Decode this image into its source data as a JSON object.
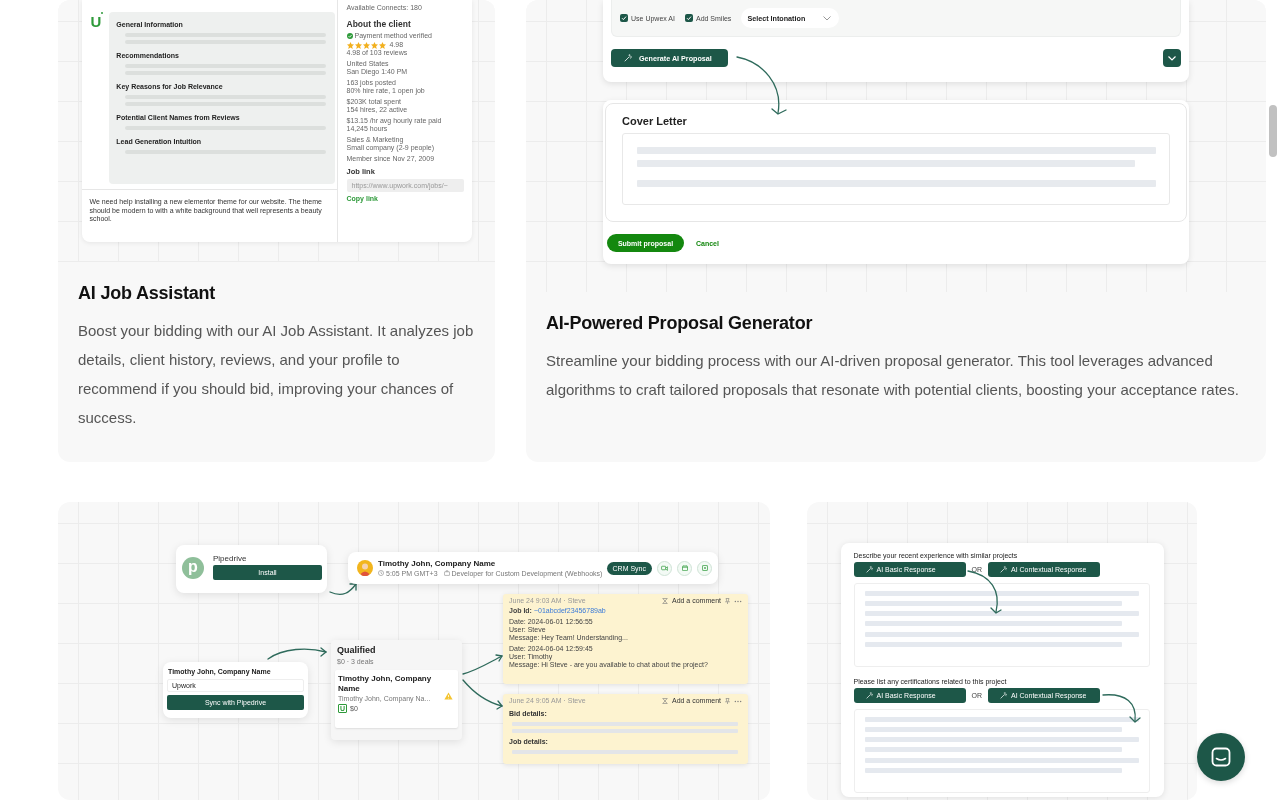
{
  "job_assistant_card": {
    "mockup": {
      "available_connects": "Available Connects: 180",
      "logo": "U",
      "sections": [
        "General Information",
        "Recommendations",
        "Key Reasons for Job Relevance",
        "Potential Client Names from Reviews",
        "Lead Generation Intuition"
      ],
      "job_description": "We need help installing a new elementor theme for our website. The theme should be modern to with a white background that well represents a beauty school.",
      "client": {
        "heading": "About the client",
        "payment": "Payment method verified",
        "stars": 5,
        "rating": "4.98",
        "reviews": "4.98 of 103 reviews",
        "details": [
          {
            "lines": [
              "United States",
              "San Diego 1:40 PM"
            ]
          },
          {
            "lines": [
              "163 jobs posted",
              "80% hire rate, 1 open job"
            ]
          },
          {
            "lines": [
              "$203K total spent",
              "154 hires, 22 active"
            ]
          },
          {
            "lines": [
              "$13.15 /hr avg hourly rate paid",
              "14,245 hours"
            ]
          },
          {
            "lines": [
              "Sales & Marketing",
              "Small company (2-9 people)"
            ]
          },
          {
            "lines": [
              "Member since Nov 27, 2009"
            ]
          }
        ]
      },
      "job_link_label": "Job link",
      "job_link_value": "https://www.upwork.com/jobs/~",
      "copy_link": "Copy link"
    },
    "title": "AI Job Assistant",
    "description": "Boost your bidding with our AI Job Assistant. It analyzes job details, client history, reviews, and your profile to recommend if you should bid, improving your chances of success."
  },
  "proposal_card": {
    "mockup": {
      "options": [
        {
          "label": "Use Upwex AI",
          "checked": true
        },
        {
          "label": "Add Smiles",
          "checked": true
        }
      ],
      "intonation": {
        "placeholder": "Select Intonation"
      },
      "generate_button": "Generate AI Proposal",
      "cover_letter_title": "Cover Letter",
      "submit_button": "Submit proposal",
      "cancel_link": "Cancel"
    },
    "title": "AI-Powered Proposal Generator",
    "description": "Streamline your bidding process with our AI-driven proposal generator. This tool leverages advanced algorithms to craft tailored proposals that resonate with potential clients, boosting your acceptance rates."
  },
  "crm_card": {
    "mockup": {
      "pipedrive": {
        "logo_letter": "p",
        "name": "Pipedrive",
        "install_button": "Install"
      },
      "contact": {
        "name": "Timothy John, Company Name",
        "time": "5:05 PM GMT+3",
        "job": "Developer for Custom Development (Webhooks)",
        "sync_button": "CRM Sync"
      },
      "sync_form": {
        "name": "Timothy John, Company Name",
        "source": "Upwork",
        "button": "Sync with Pipedrive"
      },
      "stage": {
        "title": "Qualified",
        "summary": "$0 · 3 deals",
        "deal": {
          "title": "Timothy John, Company Name",
          "subtitle": "Timothy John, Company Na...",
          "logo": "U",
          "amount": "$0"
        }
      },
      "notes": [
        {
          "kind": "log",
          "header": "June 24 9:03 AM · Steve",
          "add_comment": "Add a comment",
          "job_id_label": "Job Id:",
          "job_id": "~01abcdef23456789ab",
          "entries": [
            {
              "lines": [
                "Date: 2024-06-01 12:56:55",
                "User: Steve",
                "Message: Hey Team! Understanding..."
              ]
            },
            {
              "lines": [
                "Date: 2024-06-04 12:59:45",
                "User: Timothy",
                "Message: Hi Steve - are you available to chat about the project?"
              ]
            }
          ]
        },
        {
          "kind": "details",
          "header": "June 24 9:05 AM · Steve",
          "add_comment": "Add a comment",
          "labels": [
            "Bid details:",
            "Job details:"
          ]
        }
      ]
    }
  },
  "responses_card": {
    "mockup": {
      "questions": [
        {
          "prompt": "Describe your recent experience with similar projects",
          "basic_button": "AI Basic Response",
          "separator": "OR",
          "contextual_button": "AI Contextual Response"
        },
        {
          "prompt": "Please list any certifications related to this project",
          "basic_button": "AI Basic Response",
          "separator": "OR",
          "contextual_button": "AI Contextual Response"
        }
      ]
    }
  }
}
